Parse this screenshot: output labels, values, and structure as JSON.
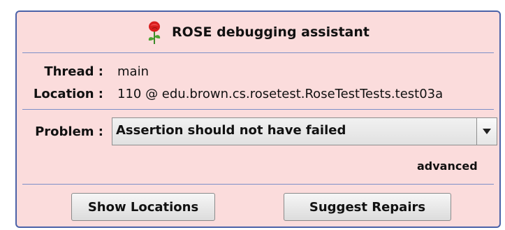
{
  "header": {
    "title": "ROSE debugging assistant",
    "icon": "rose-icon"
  },
  "info": {
    "thread_label": "Thread :",
    "thread_value": "main",
    "location_label": "Location :",
    "location_value": "110 @ edu.brown.cs.rosetest.RoseTestTests.test03a"
  },
  "problem": {
    "label": "Problem :",
    "selected": "Assertion should not have failed",
    "dropdown_icon": "triangle-down-icon"
  },
  "advanced_label": "advanced",
  "buttons": {
    "show_locations": "Show Locations",
    "suggest_repairs": "Suggest Repairs"
  },
  "colors": {
    "panel_background": "#fbdcdc",
    "border": "#4b62a8",
    "divider": "#7d8fc8"
  }
}
